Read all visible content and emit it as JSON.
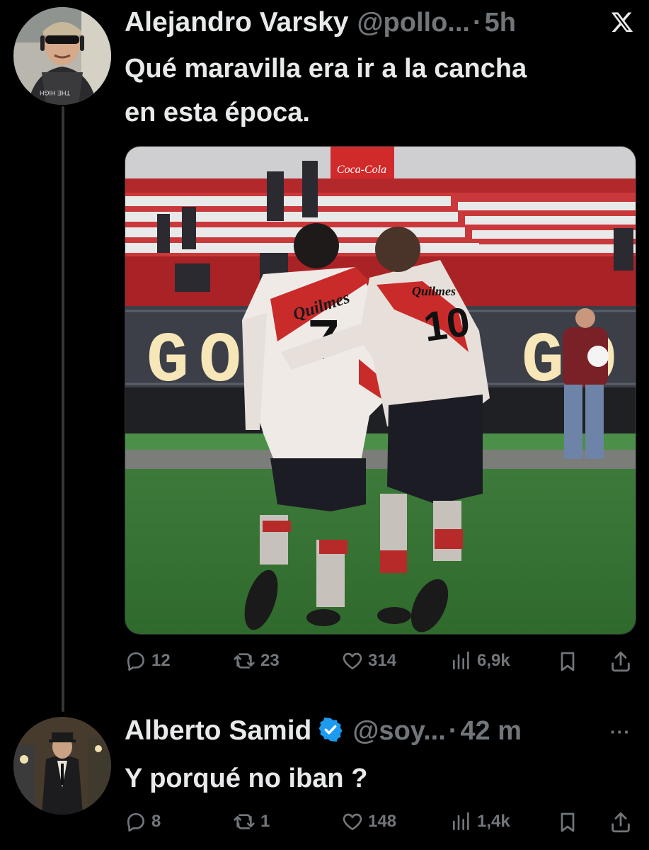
{
  "tweet1": {
    "author_name": "Alejandro Varsky",
    "handle": "@pollo...",
    "separator": "·",
    "time": "5h",
    "text_line1": "Qué maravilla era ir a la cancha",
    "text_line2": "en esta época.",
    "image": {
      "stand_sign": "Coca-Cola",
      "scoreboard_left": "GO",
      "scoreboard_right": "GO",
      "jersey_left_sponsor": "Quilmes",
      "jersey_left_number": "7",
      "jersey_right_sponsor": "Quilmes",
      "jersey_right_number": "10"
    },
    "actions": {
      "replies": "12",
      "reposts": "23",
      "likes": "314",
      "views": "6,9k"
    }
  },
  "tweet2": {
    "author_name": "Alberto Samid",
    "handle": "@soy...",
    "separator": "·",
    "time": "42 m",
    "text": "Y porqué no iban ?",
    "actions": {
      "replies": "8",
      "reposts": "1",
      "likes": "148",
      "views": "1,4k"
    }
  },
  "icons": [
    "x-logo-icon",
    "reply-icon",
    "repost-icon",
    "like-icon",
    "views-icon",
    "bookmark-icon",
    "share-icon",
    "verified-badge-icon",
    "more-icon"
  ],
  "colors": {
    "background": "#000000",
    "text": "#e7e9ea",
    "muted": "#71767b",
    "verified": "#1d9bf0"
  }
}
